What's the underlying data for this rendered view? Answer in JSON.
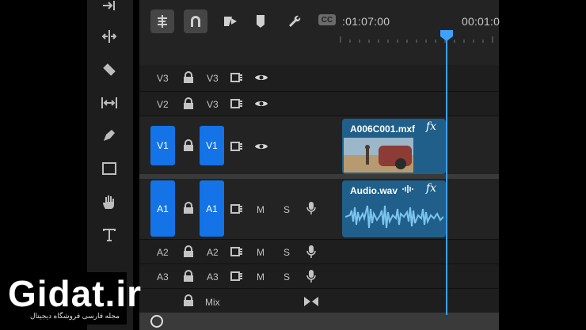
{
  "toolbar": {
    "timecode_left": ":01:07:00",
    "timecode_right": "00:01:0",
    "cc_label": "CC"
  },
  "tracks": {
    "v3": {
      "source": "V3",
      "target": "V3"
    },
    "v2": {
      "source": "V2",
      "target": "V3"
    },
    "v1": {
      "source": "V1",
      "target": "V1"
    },
    "a1": {
      "source": "A1",
      "target": "A1",
      "m": "M",
      "s": "S"
    },
    "a2": {
      "source": "A2",
      "target": "A2",
      "m": "M",
      "s": "S"
    },
    "a3": {
      "source": "A3",
      "target": "A3",
      "m": "M",
      "s": "S"
    },
    "mix": {
      "label": "Mix"
    }
  },
  "clips": {
    "video": {
      "name": "A006C001.mxf",
      "fx": "fx"
    },
    "audio": {
      "name": "Audio.wav",
      "fx": "fx"
    }
  },
  "watermark": {
    "brand": "Gidat.ir",
    "tagline": "مجله فارسی فروشگاه دیجیتال"
  },
  "colors": {
    "accent": "#1473e6",
    "clip_blue": "#1f5f8a",
    "playhead": "#3ea0ff"
  }
}
